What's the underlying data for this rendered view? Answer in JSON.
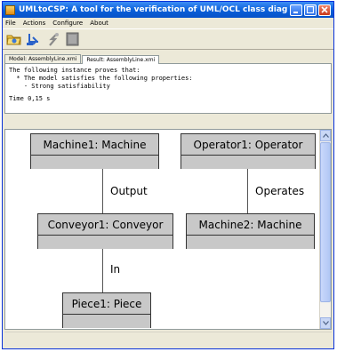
{
  "window": {
    "title": "UMLtoCSP: A tool for the verification of UML/OCL class diagrams",
    "controls": [
      "minimize",
      "maximize",
      "close"
    ]
  },
  "menu": [
    "File",
    "Actions",
    "Configure",
    "About"
  ],
  "toolbar": {
    "buttons": [
      "open-folder-icon",
      "save-icon",
      "run-icon",
      "stop-icon"
    ]
  },
  "tabs": [
    {
      "label": "Model: AssemblyLine.xmi",
      "active": false
    },
    {
      "label": "Result: AssemblyLine.xmi",
      "active": true
    }
  ],
  "result": {
    "line1": "The following instance proves that:",
    "line2": "  * The model satisfies the following properties:",
    "line3": "    - Strong satisfiability",
    "time": "Time 0,15 s"
  },
  "diagram": {
    "classes": {
      "machine1": "Machine1: Machine",
      "operator1": "Operator1: Operator",
      "conveyor1": "Conveyor1: Conveyor",
      "machine2": "Machine2: Machine",
      "piece1": "Piece1: Piece"
    },
    "associations": {
      "output": "Output",
      "operates": "Operates",
      "in": "In"
    }
  },
  "colors": {
    "titlebar": "#0a5fd8",
    "class_fill": "#c8c8c8",
    "window_bg": "#ece9d8"
  }
}
